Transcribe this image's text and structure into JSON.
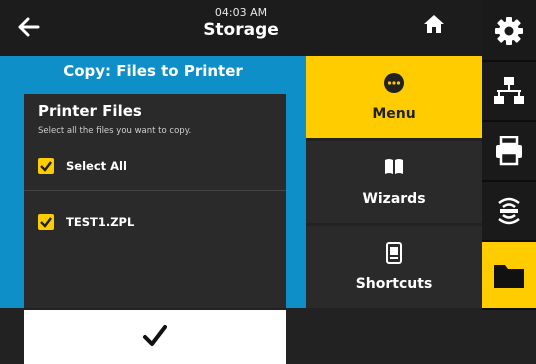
{
  "header": {
    "back_icon": "back-arrow-icon",
    "time": "04:03 AM",
    "title": "Storage",
    "home_icon": "home-icon"
  },
  "copy_panel": {
    "heading": "Copy: Files to Printer",
    "card_title": "Printer Files",
    "instruction": "Select all the files you want to copy.",
    "items": [
      {
        "label": "Select All",
        "checked": true
      },
      {
        "label": "TEST1.ZPL",
        "checked": true
      }
    ],
    "confirm_icon": "checkmark-icon"
  },
  "menu": {
    "buttons": [
      {
        "label": "Menu",
        "icon": "menu-icon",
        "active": true
      },
      {
        "label": "Wizards",
        "icon": "wizard-book-icon",
        "active": false
      },
      {
        "label": "Shortcuts",
        "icon": "shortcuts-icon",
        "active": false
      }
    ]
  },
  "sidebar": {
    "icons": [
      "gear-icon",
      "network-icon",
      "printer-icon",
      "rfid-icon",
      "folder-icon"
    ],
    "active": "folder-icon"
  },
  "colors": {
    "accent": "#ffcc00",
    "panel_blue": "#0f8fc8",
    "dark": "#2a2a2a"
  }
}
